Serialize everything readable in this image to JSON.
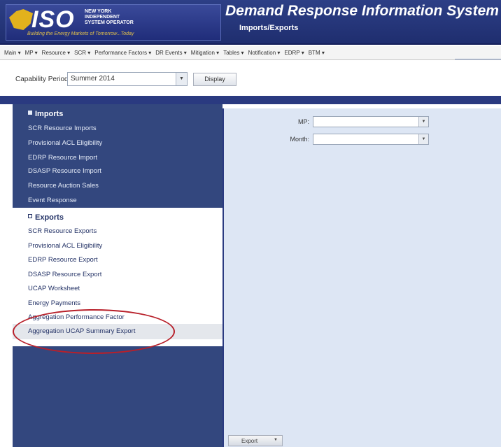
{
  "header": {
    "logo_text": "ISO",
    "logo_subtitle": "NEW YORK INDEPENDENT SYSTEM OPERATOR",
    "logo_tagline": "Building the Energy Markets of Tomorrow...Today",
    "app_title": "Demand Response Information System",
    "page_subtitle": "Imports/Exports"
  },
  "menu": {
    "items": [
      "Main ▾",
      "MP ▾",
      "Resource ▾",
      "SCR ▾",
      "Performance Factors ▾",
      "DR Events ▾",
      "Mitigation ▾",
      "Tables ▾",
      "Notification ▾",
      "EDRP ▾",
      "BTM ▾"
    ]
  },
  "toolbar": {
    "capability_label": "Capability Period:",
    "capability_value": "Summer 2014",
    "display_label": "Display"
  },
  "sidebar": {
    "imports_title": "Imports",
    "imports_items": [
      "SCR Resource Imports",
      "Provisional ACL Eligibility",
      "EDRP Resource Import",
      "DSASP Resource Import",
      "Resource Auction Sales",
      "Event Response"
    ],
    "exports_title": "Exports",
    "exports_items": [
      "SCR Resource Exports",
      "Provisional ACL Eligibility",
      "EDRP Resource Export",
      "DSASP Resource Export",
      "UCAP Worksheet",
      "Energy Payments",
      "Aggregation Performance Factor",
      "Aggregation UCAP Summary Export"
    ]
  },
  "form": {
    "mp_label": "MP:",
    "month_label": "Month:",
    "mp_value": "",
    "month_value": ""
  },
  "footer": {
    "export_label": "Export"
  },
  "colors": {
    "header_bg": "#1f2e6f",
    "sidebar_bg": "#33477e",
    "panel_bg": "#dde6f4",
    "highlight": "#b8202a"
  }
}
